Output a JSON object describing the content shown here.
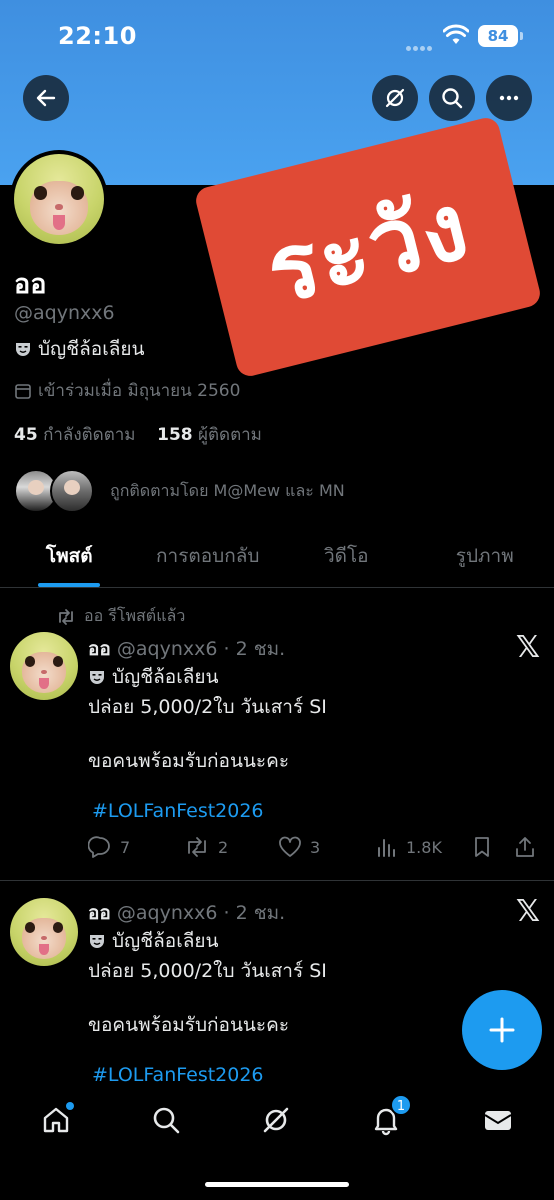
{
  "status_bar": {
    "time": "22:10",
    "battery": "84"
  },
  "profile": {
    "name": "ออ",
    "handle": "@aqynxx6",
    "parody_label": "บัญชีล้อเลียน",
    "joined": "เข้าร่วมเมื่อ มิถุนายน 2560",
    "following_count": "45",
    "following_label": "กำลังติดตาม",
    "followers_count": "158",
    "followers_label": "ผู้ติดตาม",
    "followed_by": "ถูกติดตามโดย M@Mew และ MN"
  },
  "warning_stamp": "ระวัง",
  "tabs": [
    {
      "label": "โพสต์",
      "active": true
    },
    {
      "label": "การตอบกลับ",
      "active": false
    },
    {
      "label": "วิดีโอ",
      "active": false
    },
    {
      "label": "รูปภาพ",
      "active": false
    }
  ],
  "repost_indicator": "ออ รีโพสต์แล้ว",
  "posts": [
    {
      "name": "ออ",
      "handle": "@aqynxx6",
      "time": "· 2 ชม.",
      "parody_label": "บัญชีล้อเลียน",
      "line1": "ปล่อย 5,000/2ใบ วันเสาร์ SI",
      "line2": "ขอคนพร้อมรับก่อนนะคะ",
      "hashtag": "#LOLFanFest2026",
      "replies": "7",
      "reposts": "2",
      "likes": "3",
      "views": "1.8K"
    },
    {
      "name": "ออ",
      "handle": "@aqynxx6",
      "time": "· 2 ชม.",
      "parody_label": "บัญชีล้อเลียน",
      "line1": "ปล่อย 5,000/2ใบ วันเสาร์ SI",
      "line2": "ขอคนพร้อมรับก่อนนะคะ",
      "hashtag": "#LOLFanFest2026"
    }
  ],
  "nav": {
    "notifications_badge": "1"
  },
  "colors": {
    "accent": "#1d9bf0",
    "banner": "#4aa2f0",
    "stamp": "#e04a35"
  },
  "icons": [
    "back-arrow-icon",
    "grok-icon",
    "search-icon",
    "more-icon",
    "calendar-icon",
    "theater-mask-icon",
    "repost-icon",
    "reply-icon",
    "like-icon",
    "views-icon",
    "bookmark-icon",
    "share-icon",
    "x-logo-icon",
    "compose-icon",
    "home-icon",
    "bell-icon",
    "mail-icon"
  ]
}
